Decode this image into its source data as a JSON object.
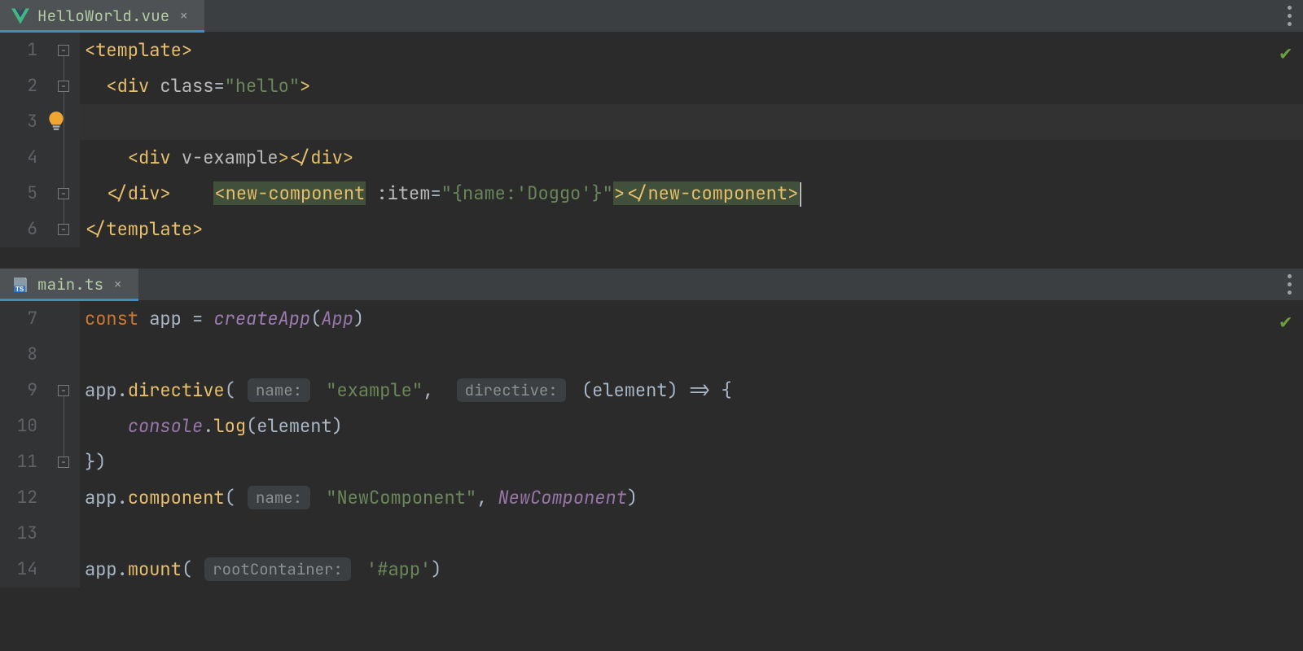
{
  "panes": {
    "top": {
      "tab": {
        "filename": "HelloWorld.vue",
        "icon": "vue"
      },
      "gutter": [
        "1",
        "2",
        "3",
        "4",
        "5",
        "6"
      ],
      "lines": {
        "l1": {
          "tag_open": "<",
          "tag": "template",
          "tag_close": ">"
        },
        "l2": {
          "tag_open": "<",
          "tag": "div ",
          "attr": "class",
          "eq": "=",
          "str": "\"hello\"",
          "close": ">"
        },
        "l3": {
          "open": "<new-component",
          "sp": " ",
          "attr": ":item",
          "eq": "=",
          "str": "\"{name:'Doggo'}\"",
          "gt": ">",
          "closeTag": "</new-component>"
        },
        "l4": {
          "tag_open": "<",
          "tag": "div ",
          "attr": "v-example",
          "close": "></div>"
        },
        "l5": {
          "text": "</div>"
        },
        "l6": {
          "text": "</template>"
        }
      }
    },
    "bottom": {
      "tab": {
        "filename": "main.ts",
        "icon": "ts"
      },
      "gutter": [
        "7",
        "8",
        "9",
        "10",
        "11",
        "12",
        "13",
        "14"
      ],
      "lines": {
        "l7": {
          "kw": "const ",
          "id": "app ",
          "op": "= ",
          "fn": "createApp",
          "paren": "(",
          "arg": "App",
          "close": ")"
        },
        "l8": {
          "blank": " "
        },
        "l9": {
          "id": "app.",
          "fn": "directive",
          "paren": "( ",
          "hint1": "name:",
          "str": "\"example\"",
          "comma": ", ",
          "hint2": "directive:",
          "rest": "(element) => {"
        },
        "l10": {
          "obj": "console",
          "dot": ".",
          "m": "log",
          "paren": "(element)"
        },
        "l11": {
          "text": "})"
        },
        "l12": {
          "id": "app.",
          "fn": "component",
          "paren": "( ",
          "hint": "name:",
          "str": "\"NewComponent\"",
          "comma": ", ",
          "ital": "NewComponent",
          "close": ")"
        },
        "l13": {
          "blank": " "
        },
        "l14": {
          "id": "app.",
          "fn": "mount",
          "paren": "( ",
          "hint": "rootContainer:",
          "str": "'#app'",
          "close": ")"
        }
      }
    }
  }
}
